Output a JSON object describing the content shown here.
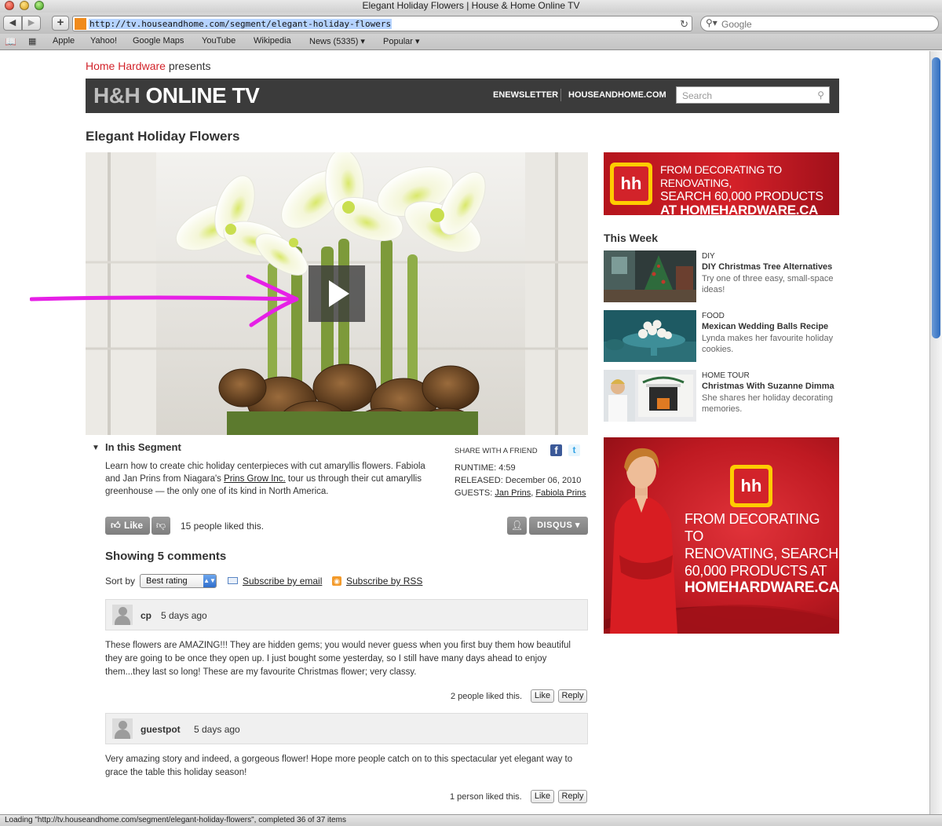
{
  "browser": {
    "window_title": "Elegant Holiday Flowers | House & Home Online TV",
    "url": "http://tv.houseandhome.com/segment/elegant-holiday-flowers",
    "search_placeholder": "Google",
    "back_label": "◀",
    "forward_label": "▶",
    "add_label": "+",
    "bookmarks": [
      "Apple",
      "Yahoo!",
      "Google Maps",
      "YouTube",
      "Wikipedia",
      "News (5335) ▾",
      "Popular ▾"
    ],
    "status": "Loading \"http://tv.houseandhome.com/segment/elegant-holiday-flowers\", completed 36 of 37 items"
  },
  "presents": {
    "brand": "Home Hardware",
    "suffix": " presents"
  },
  "header": {
    "logo_hh": "H&H",
    "logo_rest": " ONLINE TV",
    "links": [
      "ENEWSLETTER",
      "HOUSEANDHOME.COM"
    ],
    "search_placeholder": "Search"
  },
  "page": {
    "title": "Elegant Holiday Flowers"
  },
  "annotation": {
    "color": "#e620e6"
  },
  "segment": {
    "heading": "In this Segment",
    "desc_before": "Learn how to create chic holiday centerpieces with cut amaryllis flowers. Fabiola and Jan Prins from Niagara's ",
    "desc_link": "Prins Grow Inc.",
    "desc_after": " tour us through their cut amaryllis greenhouse — the only one of its kind in North America.",
    "share_label": "SHARE WITH A FRIEND",
    "runtime": "RUNTIME: 4:59",
    "released": "RELEASED: December 06, 2010",
    "guests_label": "GUESTS: ",
    "guest_1": "Jan Prins",
    "guest_sep": ", ",
    "guest_2": "Fabiola Prins"
  },
  "disqus": {
    "like_label": "Like",
    "likes_text": "15 people liked this.",
    "brand_label": "DISQUS ▾",
    "comments_heading": "Showing 5 comments",
    "sort_label": "Sort by",
    "sort_value": "Best rating",
    "subscribe_email": "Subscribe by email",
    "subscribe_rss": "Subscribe by RSS",
    "comments": [
      {
        "author": "cp",
        "time": "5 days ago",
        "body": "These flowers are AMAZING!!! They are hidden gems; you would never guess when you first buy them how beautiful they are going to be once they open up. I just bought some yesterday, so I still have many days ahead to enjoy them...they last so long! These are my favourite Christmas flower; very classy.",
        "likes": "2 people liked this.",
        "like_btn": "Like",
        "reply_btn": "Reply"
      },
      {
        "author": "guestpot",
        "time": "5 days ago",
        "body": "Very amazing story and indeed, a gorgeous flower! Hope more people catch on to this spectacular yet elegant way to grace the table this holiday season!",
        "likes": "1 person liked this.",
        "like_btn": "Like",
        "reply_btn": "Reply"
      }
    ]
  },
  "sidebar": {
    "ad_top": {
      "line1": "FROM DECORATING TO RENOVATING,",
      "line2": "SEARCH 60,000 PRODUCTS",
      "line3": "AT HOMEHARDWARE.CA"
    },
    "this_week": "This Week",
    "items": [
      {
        "category": "DIY",
        "title": "DIY Christmas Tree Alternatives",
        "desc": "Try one of three easy, small-space ideas!"
      },
      {
        "category": "FOOD",
        "title": "Mexican Wedding Balls Recipe",
        "desc": "Lynda makes her favourite holiday cookies."
      },
      {
        "category": "HOME TOUR",
        "title": "Christmas With Suzanne Dimma",
        "desc": "She shares her holiday decorating memories."
      }
    ],
    "ad_big": {
      "line1": "FROM DECORATING TO",
      "line2": "RENOVATING, SEARCH",
      "line3": "60,000 PRODUCTS AT",
      "line4": "HOMEHARDWARE.CA"
    }
  }
}
